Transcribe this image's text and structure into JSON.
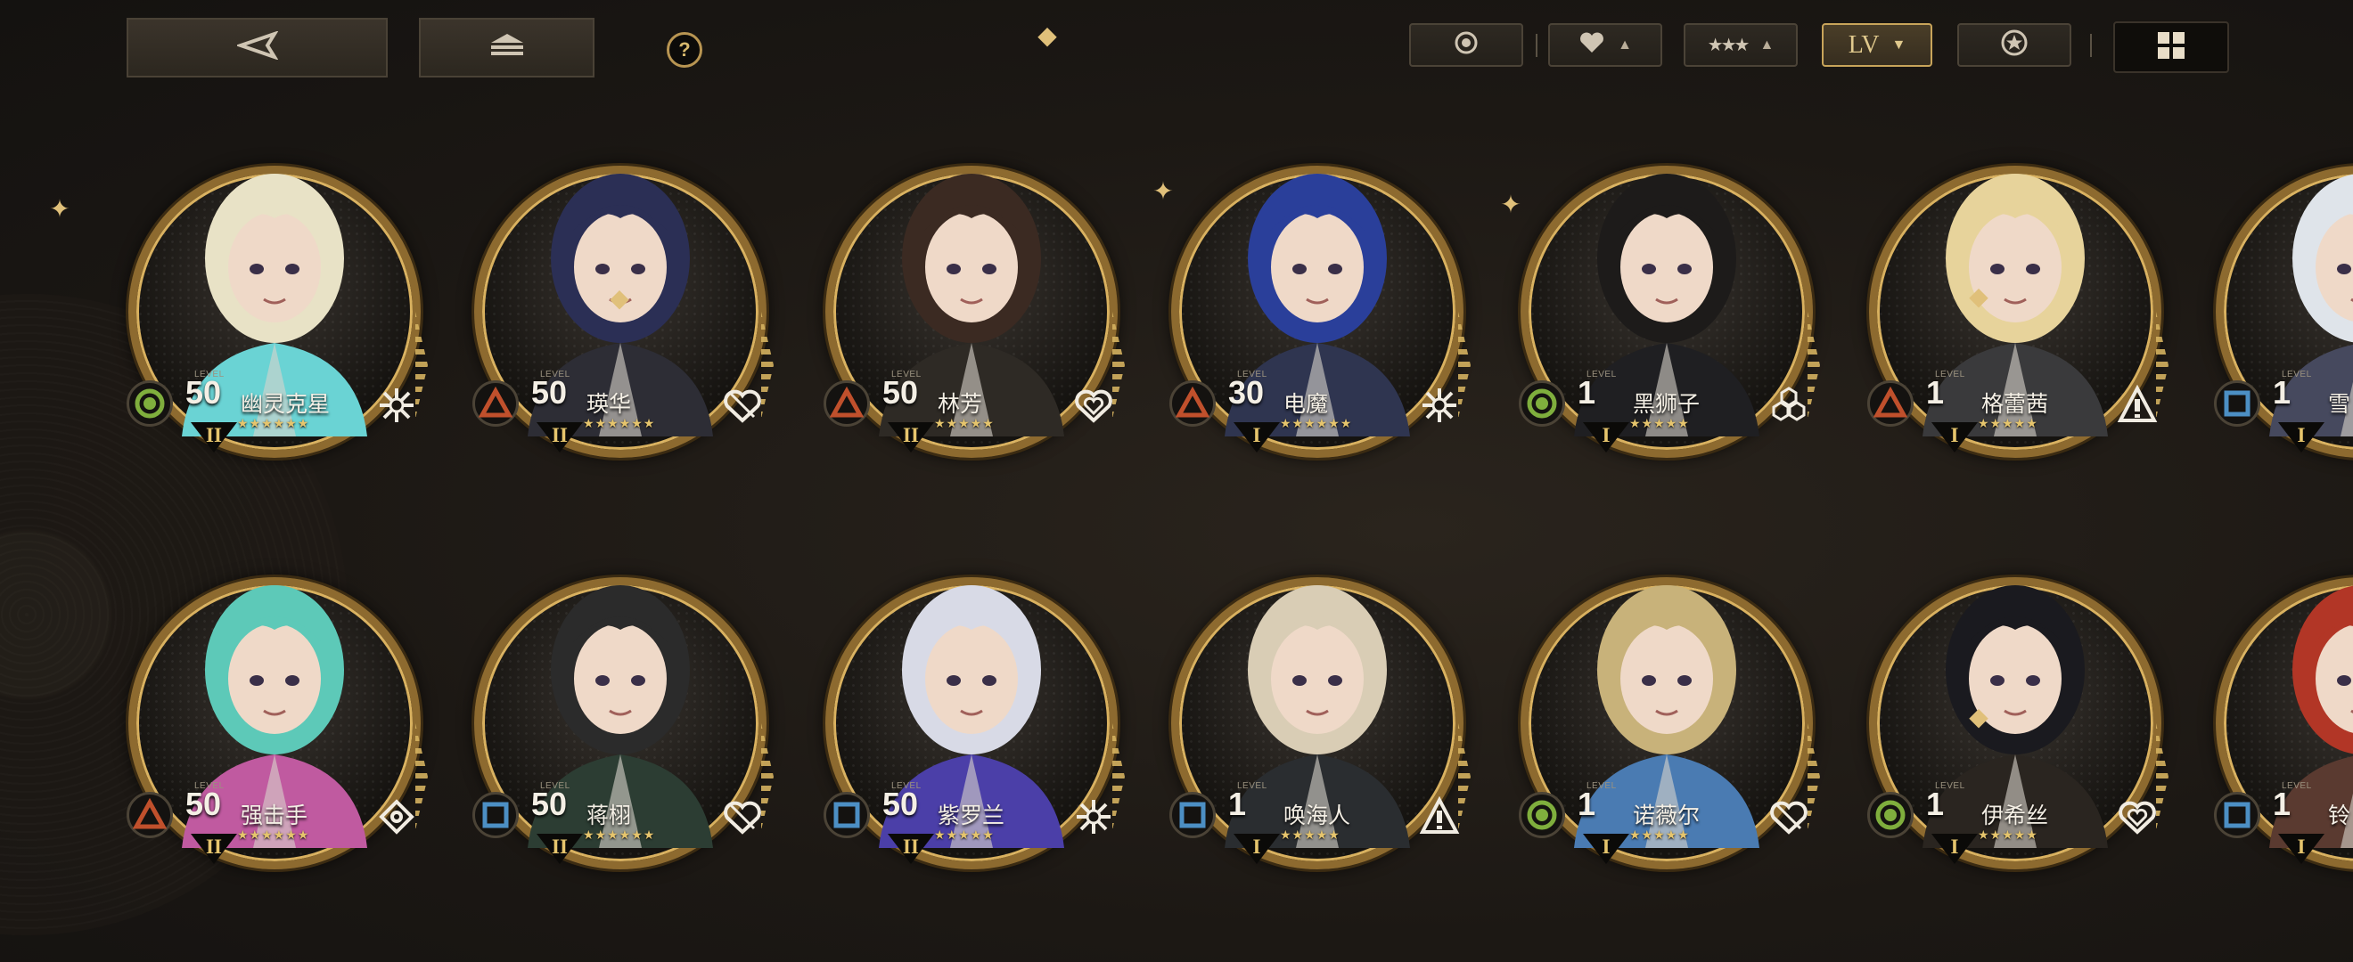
{
  "toolbar": {
    "back_icon": "back-arrow-icon",
    "home_icon": "stack-icon",
    "help_label": "?",
    "filters": [
      {
        "id": "attribute",
        "icon": "circle-dot-icon",
        "active": false
      },
      {
        "id": "affinity",
        "icon": "heart-icon",
        "arrow": "▲",
        "active": false
      },
      {
        "id": "rarity",
        "icon": "stars-icon",
        "arrow": "▲",
        "active": false
      },
      {
        "id": "level",
        "label": "LV",
        "arrow": "▼",
        "active": true
      },
      {
        "id": "favorite",
        "icon": "star-badge-icon",
        "active": false
      }
    ],
    "grid_icon": "grid-icon"
  },
  "colors": {
    "gold": "#d9b15f",
    "green_attr": "#7fae3d",
    "red_attr": "#c0502c",
    "blue_attr": "#4c8fc4"
  },
  "characters": [
    {
      "name": "幽灵克星",
      "level": "50",
      "rank": "II",
      "stars": "★★★★★★",
      "attribute": "circle",
      "cls_icon": "snowflake-icon"
    },
    {
      "name": "瑛华",
      "level": "50",
      "rank": "II",
      "stars": "★★★★★★",
      "attribute": "triangle",
      "cls_icon": "shield-heart-icon"
    },
    {
      "name": "林芳",
      "level": "50",
      "rank": "II",
      "stars": "★★★★★",
      "attribute": "triangle",
      "cls_icon": "heart-outline-icon"
    },
    {
      "name": "电魔",
      "level": "30",
      "rank": "I",
      "stars": "★★★★★★",
      "attribute": "triangle",
      "cls_icon": "snowflake-icon"
    },
    {
      "name": "黑狮子",
      "level": "1",
      "rank": "I",
      "stars": "★★★★★",
      "attribute": "circle",
      "cls_icon": "hex-cluster-icon"
    },
    {
      "name": "格蕾茜",
      "level": "1",
      "rank": "I",
      "stars": "★★★★★",
      "attribute": "triangle",
      "cls_icon": "warning-triangle-icon"
    },
    {
      "name": "雪",
      "level": "1",
      "rank": "I",
      "stars": "",
      "attribute": "square",
      "cls_icon": ""
    },
    {
      "name": "强击手",
      "level": "50",
      "rank": "II",
      "stars": "★★★★★★",
      "attribute": "triangle",
      "cls_icon": "crosshair-icon"
    },
    {
      "name": "蒋栩",
      "level": "50",
      "rank": "II",
      "stars": "★★★★★★",
      "attribute": "square",
      "cls_icon": "shield-heart-icon"
    },
    {
      "name": "紫罗兰",
      "level": "50",
      "rank": "II",
      "stars": "★★★★★",
      "attribute": "square",
      "cls_icon": "snowflake-icon"
    },
    {
      "name": "唤海人",
      "level": "1",
      "rank": "I",
      "stars": "★★★★★",
      "attribute": "square",
      "cls_icon": "warning-triangle-icon"
    },
    {
      "name": "诺薇尔",
      "level": "1",
      "rank": "I",
      "stars": "★★★★★",
      "attribute": "circle",
      "cls_icon": "shield-heart-icon"
    },
    {
      "name": "伊希丝",
      "level": "1",
      "rank": "I",
      "stars": "★★★★★",
      "attribute": "circle",
      "cls_icon": "heart-outline-icon"
    },
    {
      "name": "铃",
      "level": "1",
      "rank": "I",
      "stars": "",
      "attribute": "square",
      "cls_icon": ""
    }
  ],
  "level_caption": "LEVEL"
}
